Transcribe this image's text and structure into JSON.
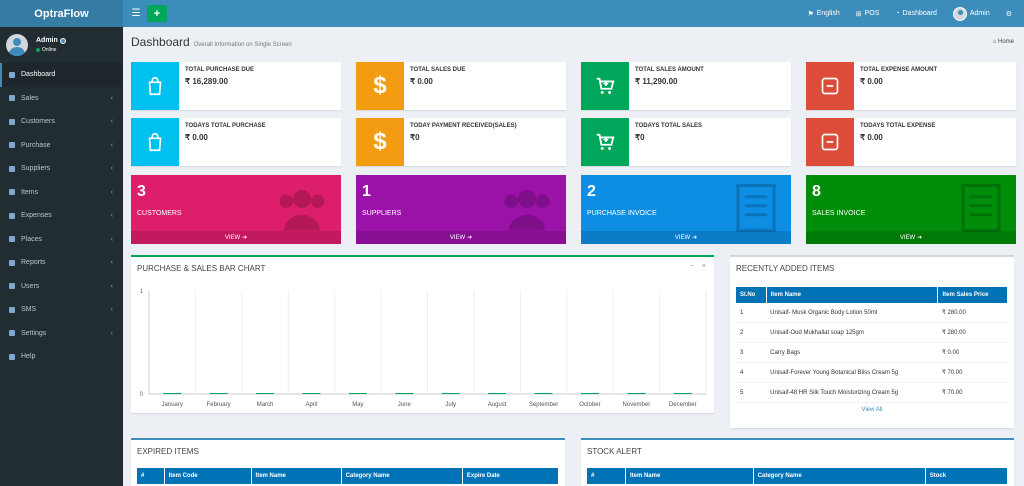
{
  "app": {
    "title": "OptraFlow"
  },
  "navbar": {
    "toggle_icon": "bars-icon",
    "add_icon": "plus-icon",
    "add_label": "+",
    "items": [
      {
        "label": "English",
        "icon": "flag-icon"
      },
      {
        "label": "POS",
        "icon": "plus-square-icon"
      },
      {
        "label": "Dashboard",
        "icon": "dashboard-icon"
      },
      {
        "label": "Admin",
        "icon": "avatar"
      },
      {
        "label": "",
        "icon": "gears-icon"
      }
    ]
  },
  "sidebar": {
    "user": {
      "name": "Admin",
      "status": "Online"
    },
    "items": [
      {
        "label": "Dashboard",
        "active": true,
        "has_children": false
      },
      {
        "label": "Sales",
        "has_children": true
      },
      {
        "label": "Customers",
        "has_children": true
      },
      {
        "label": "Purchase",
        "has_children": true
      },
      {
        "label": "Suppliers",
        "has_children": true
      },
      {
        "label": "Items",
        "has_children": true
      },
      {
        "label": "Expenses",
        "has_children": true
      },
      {
        "label": "Places",
        "has_children": true
      },
      {
        "label": "Reports",
        "has_children": true
      },
      {
        "label": "Users",
        "has_children": true
      },
      {
        "label": "SMS",
        "has_children": true
      },
      {
        "label": "Settings",
        "has_children": true
      },
      {
        "label": "Help",
        "has_children": false
      }
    ]
  },
  "page": {
    "title": "Dashboard",
    "subtitle": "Overall Information on Single Screen",
    "breadcrumb": "Home"
  },
  "info_boxes": [
    {
      "label": "TOTAL PURCHASE DUE",
      "value": "₹ 16,289.00",
      "color": "#00c0ef",
      "icon": "shopping-bag-icon"
    },
    {
      "label": "TOTAL SALES DUE",
      "value": "₹ 0.00",
      "color": "#f39c12",
      "icon": "dollar-icon"
    },
    {
      "label": "TOTAL SALES AMOUNT",
      "value": "₹ 11,290.00",
      "color": "#00a65a",
      "icon": "cart-plus-icon"
    },
    {
      "label": "TOTAL EXPENSE AMOUNT",
      "value": "₹ 0.00",
      "color": "#dd4b39",
      "icon": "minus-square-icon"
    },
    {
      "label": "TODAYS TOTAL PURCHASE",
      "value": "₹ 0.00",
      "color": "#00c0ef",
      "icon": "shopping-bag-icon"
    },
    {
      "label": "TODAY PAYMENT RECEIVED(SALES)",
      "value": "₹0",
      "color": "#f39c12",
      "icon": "dollar-icon"
    },
    {
      "label": "TODAYS TOTAL SALES",
      "value": "₹0",
      "color": "#00a65a",
      "icon": "cart-plus-icon"
    },
    {
      "label": "TODAYS TOTAL EXPENSE",
      "value": "₹ 0.00",
      "color": "#dd4b39",
      "icon": "minus-square-icon"
    }
  ],
  "small_boxes": [
    {
      "count": "3",
      "label": "CUSTOMERS",
      "footer": "VIEW",
      "color": "#dd1e6b",
      "icon": "users-icon"
    },
    {
      "count": "1",
      "label": "SUPPLIERS",
      "footer": "VIEW",
      "color": "#9b12a8",
      "icon": "users-icon"
    },
    {
      "count": "2",
      "label": "PURCHASE INVOICE",
      "footer": "VIEW",
      "color": "#0d8ee3",
      "icon": "invoice-icon"
    },
    {
      "count": "8",
      "label": "SALES INVOICE",
      "footer": "VIEW",
      "color": "#008d0a",
      "icon": "invoice-icon"
    }
  ],
  "chart_box": {
    "title": "PURCHASE & SALES BAR CHART",
    "tools": [
      "−",
      "×"
    ]
  },
  "chart_data": {
    "type": "bar",
    "title": "PURCHASE & SALES BAR CHART",
    "categories": [
      "January",
      "February",
      "March",
      "April",
      "May",
      "June",
      "July",
      "August",
      "September",
      "October",
      "November",
      "December"
    ],
    "series": [
      {
        "values": [
          0,
          0,
          0,
          0,
          0,
          0,
          0,
          0,
          0,
          0,
          0,
          0
        ],
        "color": "#00a65a"
      }
    ],
    "ylim": [
      0,
      1
    ],
    "y_ticks": [
      "0",
      "1"
    ],
    "grid": true
  },
  "recent_items": {
    "title": "RECENTLY ADDED ITEMS",
    "columns": [
      "Sl.No",
      "Item Name",
      "Item Sales Price"
    ],
    "rows": [
      [
        "1",
        "Unisaif- Musk Organic Body Lotion 50ml",
        "₹ 280.00"
      ],
      [
        "2",
        "Unisaif-Oud Mukhallat soap 125gm",
        "₹ 280.00"
      ],
      [
        "3",
        "Carry Bags",
        "₹ 0.00"
      ],
      [
        "4",
        "Unisaif-Forever Young Botanical Bliss Cream 5g",
        "₹ 70.00"
      ],
      [
        "5",
        "Unisaif-48 HR Silk Touch Moisturizing Cream 5g",
        "₹ 70.00"
      ]
    ],
    "view_all": "View All"
  },
  "expired_items": {
    "title": "EXPIRED ITEMS",
    "columns": [
      "#",
      "Item Code",
      "Item Name",
      "Category Name",
      "Expire Date"
    ]
  },
  "stock_alert": {
    "title": "STOCK ALERT",
    "columns": [
      "#",
      "Item Name",
      "Category Name",
      "Stock"
    ]
  }
}
